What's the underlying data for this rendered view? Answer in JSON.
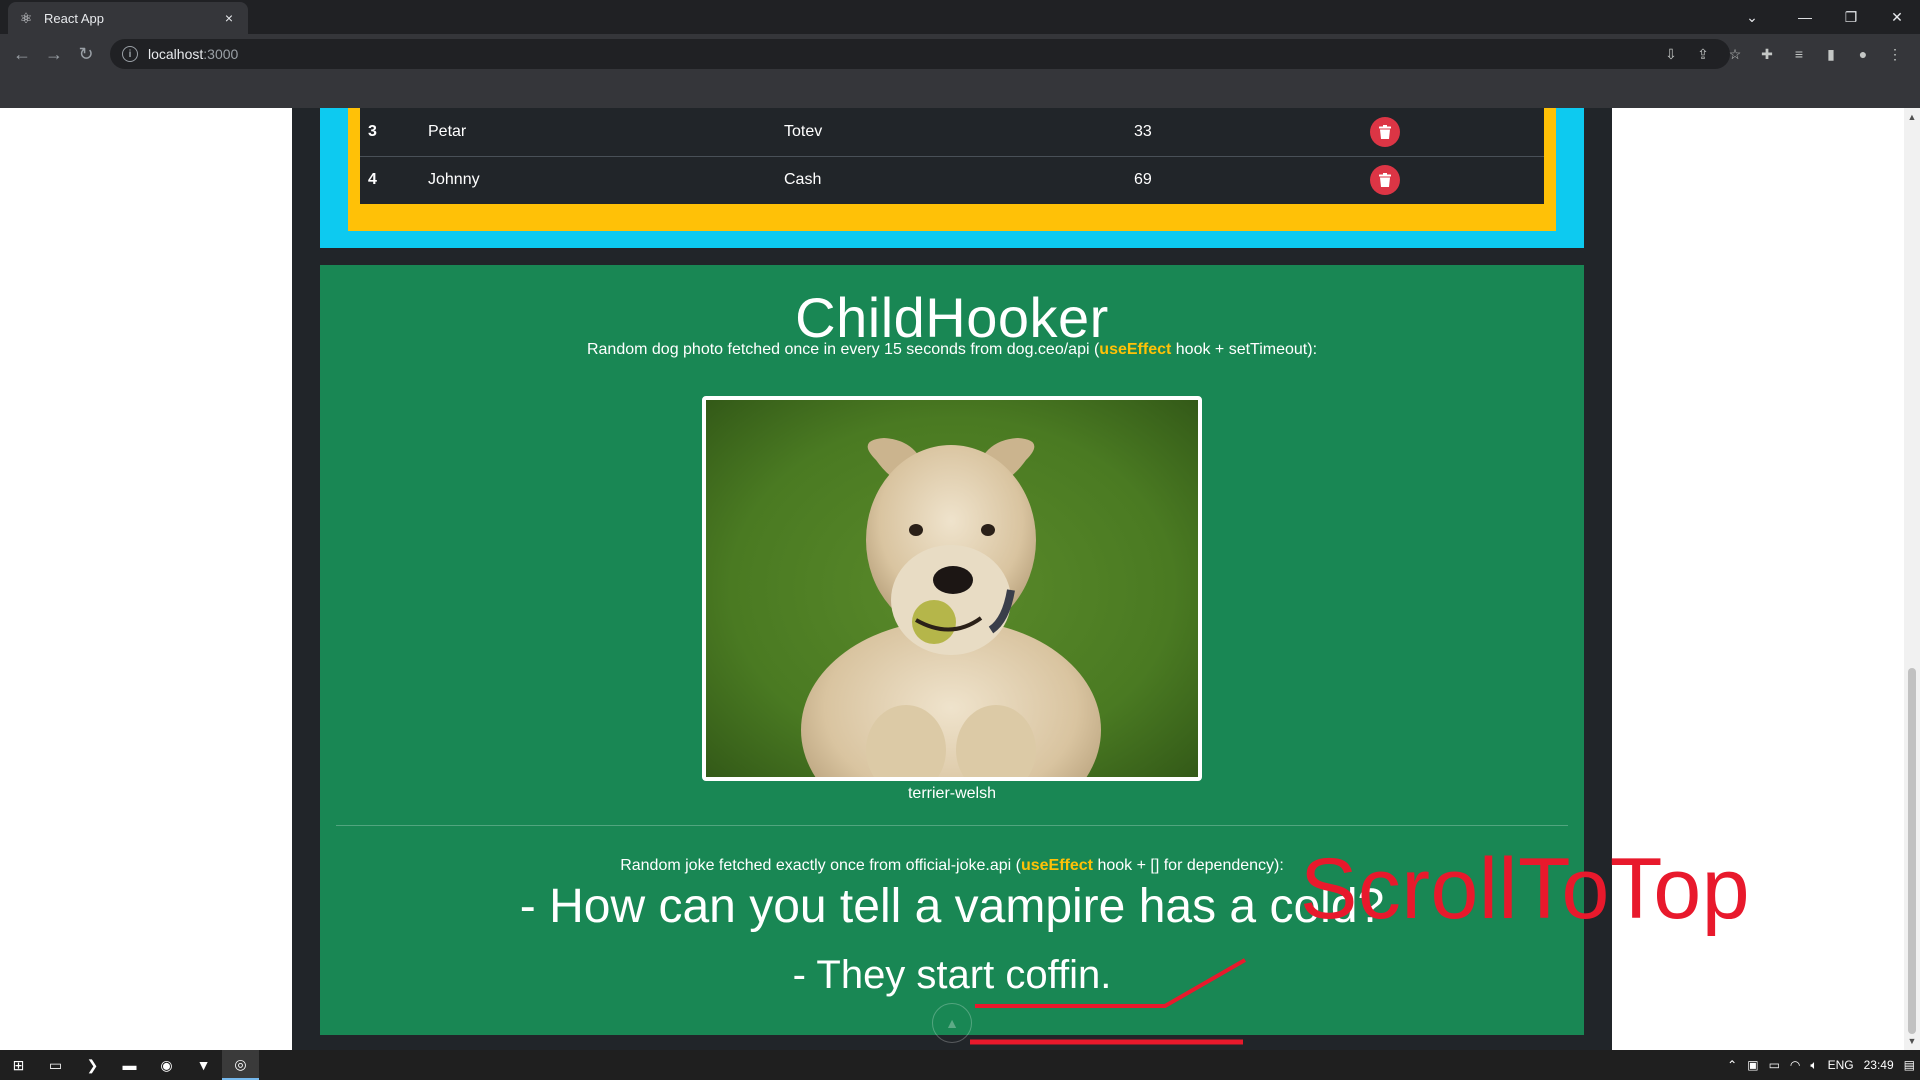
{
  "browser": {
    "tab_title": "React App",
    "tab_close": "×",
    "url_host": "localhost",
    "url_port": ":3000"
  },
  "table": {
    "rows": [
      {
        "id": "3",
        "first_name": "Petar",
        "last_name": "Totev",
        "age": "33"
      },
      {
        "id": "4",
        "first_name": "Johnny",
        "last_name": "Cash",
        "age": "69"
      }
    ]
  },
  "child_hooker": {
    "title": "ChildHooker",
    "dog_desc_before": "Random dog photo fetched once in every 15 seconds from dog.ceo/api (",
    "dog_desc_highlight": "useEffect",
    "dog_desc_after": " hook + setTimeout):",
    "breed": "terrier-welsh",
    "joke_desc_before": "Random joke fetched exactly once from official-joke.api (",
    "joke_desc_highlight": "useEffect",
    "joke_desc_after": " hook + [] for dependency):",
    "joke_setup": "- How can you tell a vampire has a cold?",
    "joke_punchline": "- They start coffin."
  },
  "annotation": {
    "text": "ScrollToTop",
    "color": "#e8192c"
  },
  "taskbar": {
    "language": "ENG",
    "time": "23:49"
  },
  "colors": {
    "card_green": "#198754",
    "frame_blue": "#0dcaf0",
    "frame_yellow": "#ffc107",
    "delete_red": "#dc3545",
    "highlight": "#ffc107"
  }
}
